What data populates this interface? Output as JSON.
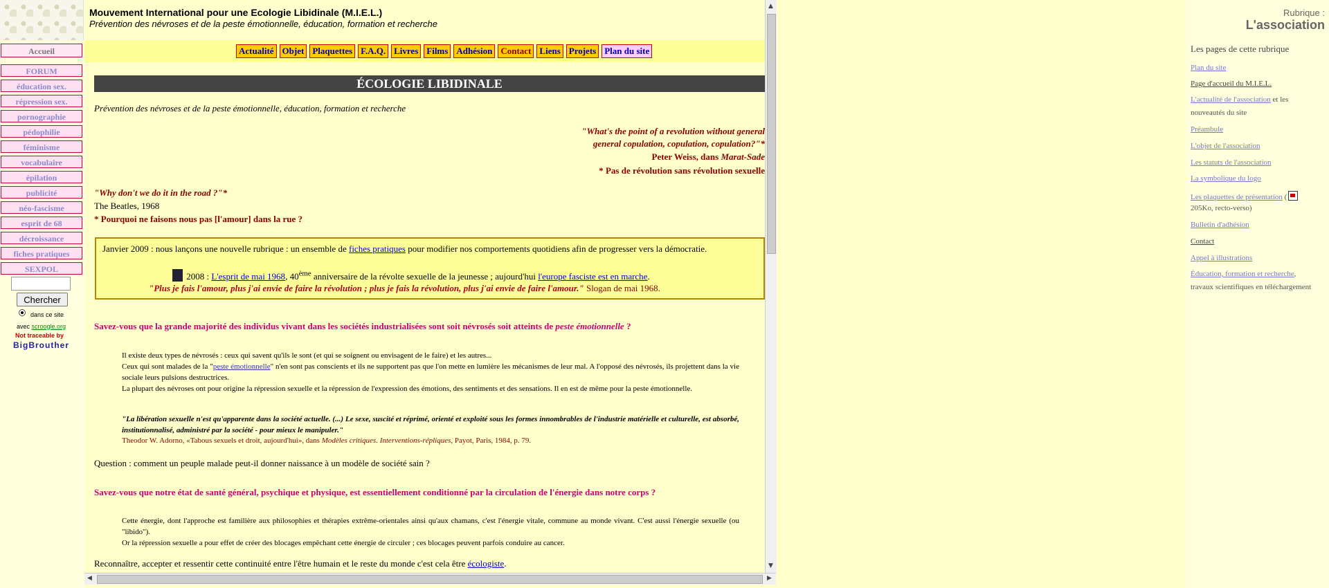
{
  "header": {
    "title": "Mouvement International pour une Ecologie Libidinale (M.I.E.L.)",
    "subtitle": "Prévention des névroses et de la peste émotionnelle, éducation, formation et recherche"
  },
  "sidebar": {
    "items": [
      {
        "label": "Accueil"
      },
      {
        "label": "FORUM"
      },
      {
        "label": "éducation sex."
      },
      {
        "label": "répression sex."
      },
      {
        "label": "pornographie"
      },
      {
        "label": "pédophilie"
      },
      {
        "label": "féminisme"
      },
      {
        "label": "vocabulaire"
      },
      {
        "label": "épilation"
      },
      {
        "label": "publicité"
      },
      {
        "label": "néo-fascisme"
      },
      {
        "label": "esprit de 68"
      },
      {
        "label": "décroissance"
      },
      {
        "label": "fiches pratiques"
      },
      {
        "label": "SEXPOL"
      }
    ],
    "search_button": "Chercher",
    "radio_label": "dans ce site",
    "avec": "avec",
    "scroogle": "scroogle.org",
    "not_traceable": "Not traceable by",
    "bigbrother": "BigBrouther"
  },
  "topnav": {
    "items": [
      {
        "label": "Actualité"
      },
      {
        "label": "Objet"
      },
      {
        "label": "Plaquettes"
      },
      {
        "label": "F.A.Q."
      },
      {
        "label": "Livres"
      },
      {
        "label": "Films"
      },
      {
        "label": "Adhésion"
      },
      {
        "label": "Contact"
      },
      {
        "label": "Liens"
      },
      {
        "label": "Projets"
      },
      {
        "label": "Plan du site"
      }
    ]
  },
  "main": {
    "heading": "ÉCOLOGIE LIBIDINALE",
    "intro": "Prévention des névroses et de la peste émotionnelle, éducation, formation et recherche",
    "quote1_line1": "\"What's the point of a revolution without general",
    "quote1_line2": "general copulation, copulation, copulation?\"*",
    "quote1_author": "Peter Weiss, dans",
    "quote1_work": "Marat-Sade",
    "quote1_note": "* Pas de révolution sans révolution sexuelle",
    "quote2": "\"Why don't we do it in the road ?\"*",
    "quote2_author": "The Beatles, 1968",
    "quote2_note": "* Pourquoi ne faisons nous pas [l'amour] dans la rue ?",
    "box": {
      "line1_pre": "Janvier 2009 : nous lançons une nouvelle rubrique : un ensemble de",
      "line1_link": "fiches pratiques",
      "line1_post": "pour modifier nos comportements quotidiens afin de progresser vers la démocratie.",
      "line2_pre": "2008 :",
      "line2_link1": "L'esprit de mai 1968",
      "line2_mid": ", 40",
      "line2_sup": "ème",
      "line2_post": "anniversaire de la révolte sexuelle de la jeunesse ; aujourd'hui",
      "line2_link2": "l'europe fasciste est en marche",
      "line2_end": ".",
      "line3_quote": "\"Plus je fais l'amour, plus j'ai envie de faire la révolution ; plus je fais la révolution, plus j'ai envie de faire l'amour.\"",
      "line3_slogan": "Slogan de mai 1968."
    },
    "q1_heading_pre": "Savez-vous que la grande majorité des individus vivant dans les sociétés industrialisées sont soit névrosés soit atteints de",
    "q1_heading_em": "peste émotionnelle",
    "q1_heading_post": "?",
    "p1": "Il existe deux types de névrosés : ceux qui savent qu'ils le sont (et qui se soignent ou envisagent de le faire) et les autres...",
    "p2_pre": "Ceux qui sont malades de la \"",
    "p2_link": "peste émotionnelle",
    "p2_post": "\" n'en sont pas conscients et  ils ne supportent pas que l'on mette en lumière les mécanismes de leur mal. A l'opposé des névrosés, ils projettent dans la vie sociale leurs pulsions destructrices.",
    "p3": "La plupart des névroses ont pour origine la répression sexuelle et la répression de l'expression des émotions, des sentiments et des sensations. Il en est de même pour la peste émotionnelle.",
    "adorno_quote": "\"La libération sexuelle n'est qu'apparente dans la société actuelle. (...) Le sexe, suscité et réprimé, orienté et exploité sous les formes innombrables de l'industrie matérielle et culturelle, est absorbé, institutionnalisé, administré par la société - pour mieux le manipuler.\"",
    "adorno_cite_pre": "Theodor W. Adorno, «Tabous sexuels et droit, aujourd'hui», dans",
    "adorno_cite_em": "Modèles critiques. Interventions-répliques",
    "adorno_cite_post": ", Payot, Paris, 1984, p. 79.",
    "question": "Question : comment un peuple malade peut-il donner naissance à un modèle de société sain ?",
    "q2_heading": "Savez-vous que notre état de santé général, psychique et physique, est essentiellement conditionné par la circulation de l'énergie dans notre corps ?",
    "p4": "Cette énergie, dont l'approche est familière aux philosophies et thérapies extrême-orientales ainsi qu'aux chamans, c'est l'énergie vitale, commune au monde vivant. C'est aussi l'énergie sexuelle (ou \"libido\").",
    "p5": "Or la répression sexuelle a pour effet de créer des blocages empêchant cette énergie de circuler ; ces blocages peuvent parfois conduire au cancer.",
    "last_pre": "Reconnaître, accepter et ressentir cette continuité entre l'être humain et le reste du monde c'est cela être",
    "last_link": "écologiste",
    "last_post": "."
  },
  "right": {
    "rubrique": "Rubrique :",
    "title": "L'association",
    "section_title": "Les pages de cette rubrique",
    "links": [
      {
        "label": "Plan du site"
      },
      {
        "label": "Page d'accueil du M.I.E.L."
      },
      {
        "label": "L'actualité de l'association",
        "suffix": "et les"
      },
      {
        "label": "Préambule"
      },
      {
        "label": "L'objet de l'association"
      },
      {
        "label": "Les statuts de l'association"
      },
      {
        "label": "La symbolique du logo"
      },
      {
        "label": "Les plaquettes de présentation",
        "suffix": "("
      },
      {
        "label": "Bulletin d'adhésion"
      },
      {
        "label": "Contact"
      },
      {
        "label": "Appel à illustrations"
      },
      {
        "label": "Éducation, formation et recherche",
        "suffix": ","
      }
    ],
    "nouveautes": "nouveautés du site",
    "plaquettes_size": "205Ko, recto-verso)",
    "travaux": "travaux scientifiques en téléchargement"
  }
}
